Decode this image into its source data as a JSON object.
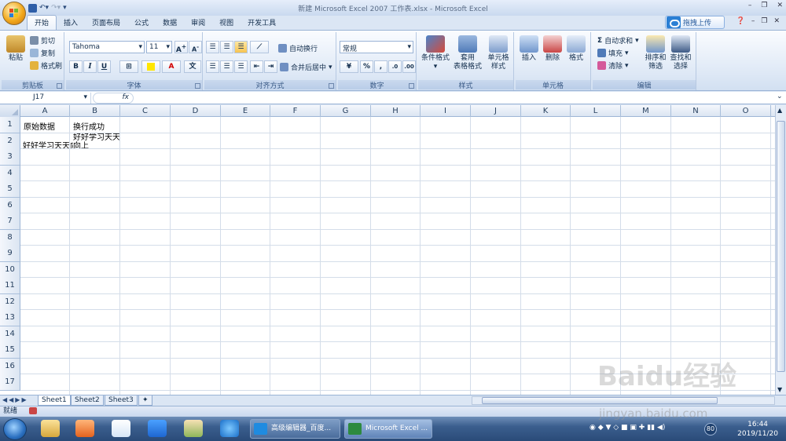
{
  "window": {
    "title": "新建 Microsoft Excel 2007 工作表.xlsx - Microsoft Excel"
  },
  "tabs": [
    "开始",
    "插入",
    "页面布局",
    "公式",
    "数据",
    "审阅",
    "视图",
    "开发工具"
  ],
  "active_tab": "开始",
  "upload_label": "拖拽上传",
  "ribbon": {
    "clipboard": {
      "label": "剪贴板",
      "paste": "粘贴",
      "cut": "剪切",
      "copy": "复制",
      "format_painter": "格式刷"
    },
    "font": {
      "label": "字体",
      "font_name": "Tahoma",
      "font_size": "11",
      "bold": "B",
      "italic": "I",
      "underline": "U",
      "grow": "A",
      "shrink": "A"
    },
    "alignment": {
      "label": "对齐方式",
      "wrap_text": "自动换行",
      "merge_center": "合并后居中"
    },
    "number": {
      "label": "数字",
      "format": "常规",
      "percent": "%"
    },
    "styles": {
      "label": "样式",
      "conditional": "条件格式",
      "table_format_1": "套用",
      "table_format_2": "表格格式",
      "cell_style_1": "单元格",
      "cell_style_2": "样式"
    },
    "cells": {
      "label": "单元格",
      "insert": "插入",
      "delete": "删除",
      "format": "格式"
    },
    "editing": {
      "label": "编辑",
      "autosum": "自动求和",
      "fill": "填充",
      "clear": "清除",
      "sort_1": "排序和",
      "sort_2": "筛选",
      "find_1": "查找和",
      "find_2": "选择"
    }
  },
  "formula_bar": {
    "name_box": "J17",
    "fx": "fx",
    "value": ""
  },
  "columns": [
    "A",
    "B",
    "C",
    "D",
    "E",
    "F",
    "G",
    "H",
    "I",
    "J",
    "K",
    "L",
    "M",
    "N",
    "O"
  ],
  "rows": [
    "1",
    "2",
    "3",
    "4",
    "5",
    "6",
    "7",
    "8",
    "9",
    "10",
    "11",
    "12",
    "13",
    "14",
    "15",
    "16",
    "17"
  ],
  "cells": {
    "A1": "原始数据",
    "B1": "换行成功",
    "A2": "好好学习天天向上",
    "B2_line1": "好好学习天天",
    "B2_line2": "向上"
  },
  "sheets": [
    "Sheet1",
    "Sheet2",
    "Sheet3"
  ],
  "active_sheet": "Sheet1",
  "status": "就绪",
  "taskbar": {
    "apps": [
      "高级编辑器_百度...",
      "Microsoft Excel ..."
    ],
    "tray_badge": "80",
    "time": "16:44",
    "date": "2019/11/20"
  },
  "watermark": {
    "logo": "Baidu经验",
    "url": "jingyan.baidu.com"
  }
}
